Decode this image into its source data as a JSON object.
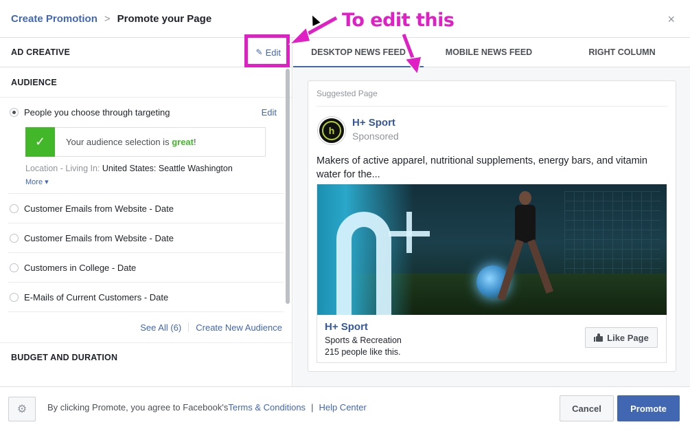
{
  "header": {
    "breadcrumb_link": "Create Promotion",
    "breadcrumb_sep": ">",
    "breadcrumb_current": "Promote your Page",
    "close": "×"
  },
  "left": {
    "ad_creative_title": "AD CREATIVE",
    "edit_label": "Edit",
    "audience_title": "AUDIENCE",
    "audiences": [
      {
        "label": "People you choose through targeting",
        "selected": true,
        "edit": "Edit"
      },
      {
        "label": "Customer Emails from Website - Date",
        "selected": false
      },
      {
        "label": "Customer Emails from Website - Date",
        "selected": false
      },
      {
        "label": "Customers in College - Date",
        "selected": false
      },
      {
        "label": "E-Mails of Current Customers - Date",
        "selected": false
      }
    ],
    "success_prefix": "Your audience selection is ",
    "success_word": "great",
    "success_suffix": "!",
    "location_label": "Location - Living In: ",
    "location_value": "United States: Seattle Washington",
    "more": "More ▾",
    "see_all": "See All (6)",
    "create_new": "Create New Audience",
    "budget_title": "BUDGET AND DURATION"
  },
  "tabs": [
    {
      "label": "DESKTOP NEWS FEED",
      "active": true
    },
    {
      "label": "MOBILE NEWS FEED",
      "active": false
    },
    {
      "label": "RIGHT COLUMN",
      "active": false
    }
  ],
  "preview": {
    "suggested": "Suggested Page",
    "avatar_letter": "h",
    "page_name": "H+ Sport",
    "sponsored": "Sponsored",
    "post_text": "Makers of active apparel, nutritional supplements, energy bars, and vitamin water for the...",
    "link_title": "H+ Sport",
    "link_category": "Sports & Recreation",
    "link_likes": "215 people like this.",
    "like_button": "Like Page"
  },
  "footer": {
    "terms_prefix": "By clicking Promote, you agree to Facebook's ",
    "terms_link": "Terms & Conditions",
    "separator": "|",
    "help_link": "Help Center",
    "cancel": "Cancel",
    "promote": "Promote"
  },
  "annotation": {
    "text": "To edit this",
    "color": "#e01fc4"
  },
  "colors": {
    "accent": "#4267b2",
    "success": "#42b72a",
    "annotation": "#e01fc4"
  }
}
